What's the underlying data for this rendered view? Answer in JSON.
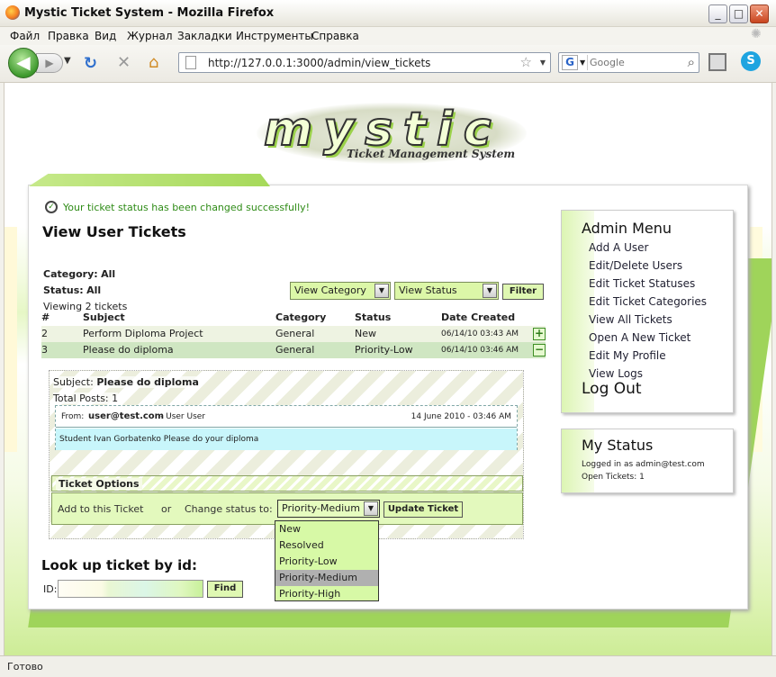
{
  "window": {
    "title": "Mystic Ticket System - Mozilla Firefox",
    "minimize": "_",
    "maximize": "□",
    "close": "✕"
  },
  "menu": [
    "Файл",
    "Правка",
    "Вид",
    "Журнал",
    "Закладки",
    "Инструменты",
    "Справка"
  ],
  "nav": {
    "url": "http://127.0.0.1:3000/admin/view_tickets",
    "search_placeholder": "Google",
    "search_engine": "G",
    "icons": [
      "back-icon",
      "forward-icon",
      "reload-icon",
      "stop-icon",
      "home-icon",
      "bookmark-star-icon",
      "search-icon"
    ]
  },
  "logo": {
    "word": "mystic",
    "tagline": "Ticket Management System"
  },
  "page": {
    "message": "Your ticket status has been changed successfully!",
    "heading": "View User Tickets",
    "category_label": "Category:",
    "category_value": "All",
    "status_label": "Status:",
    "status_value": "All",
    "viewing": "Viewing 2 tickets",
    "filter": {
      "category_select": "View Category",
      "status_select": "View Status",
      "button": "Filter"
    }
  },
  "table": {
    "headers": {
      "num": "#",
      "subject": "Subject",
      "category": "Category",
      "status": "Status",
      "date": "Date Created"
    },
    "rows": [
      {
        "num": "2",
        "subject": "Perform Diploma Project",
        "category": "General",
        "status": "New",
        "date": "06/14/10 03:43 AM",
        "toggle": "+"
      },
      {
        "num": "3",
        "subject": "Please do diploma",
        "category": "General",
        "status": "Priority-Low",
        "date": "06/14/10 03:46 AM",
        "toggle": "−"
      }
    ]
  },
  "detail": {
    "subject_label": "Subject:",
    "subject": "Please do diploma",
    "total_posts": "Total Posts: 1",
    "post": {
      "from_label": "From:",
      "from_email": "user@test.com",
      "from_name": "- User User",
      "date": "14 June 2010 - 03:46 AM",
      "body": "Student Ivan Gorbatenko Please do your diploma"
    },
    "options_title": "Ticket Options",
    "add_link": "Add to this Ticket",
    "or": "or",
    "change_label": "Change status to:",
    "status_selected": "Priority-Medium",
    "update_button": "Update Ticket",
    "status_options": [
      "New",
      "Resolved",
      "Priority-Low",
      "Priority-Medium",
      "Priority-High"
    ]
  },
  "lookup": {
    "heading": "Look up ticket by id:",
    "id_label": "ID:",
    "find_button": "Find"
  },
  "admin_menu": {
    "title": "Admin Menu",
    "items": [
      "Add A User",
      "Edit/Delete Users",
      "Edit Ticket Statuses",
      "Edit Ticket Categories",
      "View All Tickets",
      "Open A New Ticket",
      "Edit My Profile",
      "View Logs"
    ],
    "logout": "Log Out"
  },
  "my_status": {
    "title": "My Status",
    "logged_in": "Logged in as admin@test.com",
    "open_tickets": "Open Tickets: 1"
  },
  "statusbar": "Готово",
  "colors": {
    "accent": "#a6d95a",
    "success": "#2e8b16",
    "highlight_row": "#cfe6c2"
  }
}
